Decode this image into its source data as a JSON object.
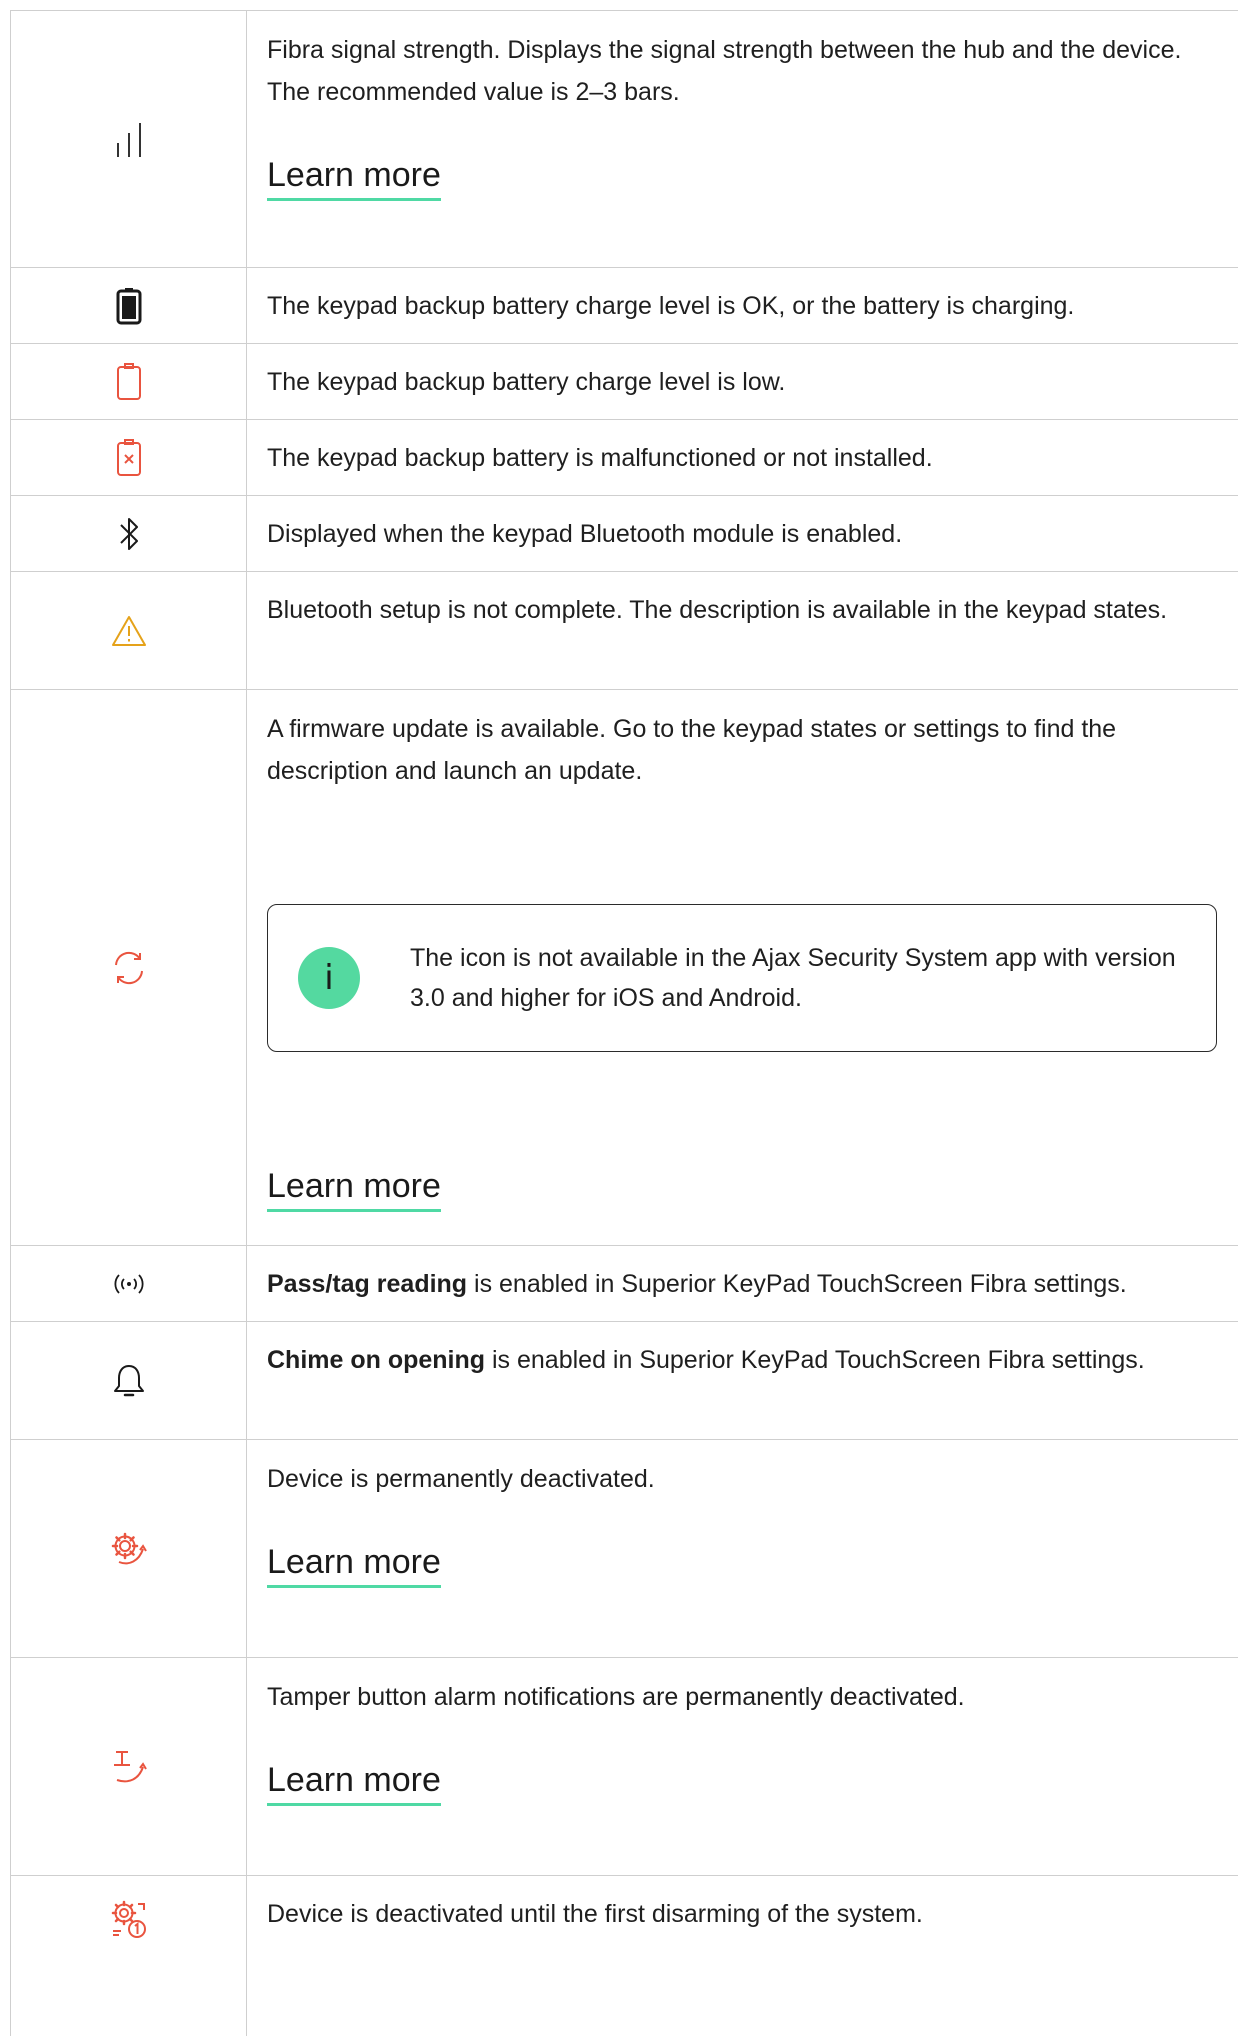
{
  "colors": {
    "red": "#e9543f",
    "yellow": "#e5a21a",
    "green": "#54d9a0",
    "border": "#cfcfcf"
  },
  "rows": [
    {
      "icon": "signal-strength-icon",
      "text": "Fibra signal strength. Displays the signal strength between the hub and the device. The recommended value is 2–3 bars.",
      "link": "Learn more"
    },
    {
      "icon": "battery-ok-icon",
      "text": "The keypad backup battery charge level is OK, or the battery is charging."
    },
    {
      "icon": "battery-low-icon",
      "text": "The keypad backup battery charge level is low."
    },
    {
      "icon": "battery-error-icon",
      "text": "The keypad backup battery is malfunctioned or not installed."
    },
    {
      "icon": "bluetooth-icon",
      "text": "Displayed when the keypad Bluetooth module is enabled."
    },
    {
      "icon": "warning-icon",
      "text": "Bluetooth setup is not complete. The description is available in the keypad states."
    },
    {
      "icon": "firmware-update-icon",
      "text": "A firmware update is available. Go to the keypad states or settings to find the description and launch an update.",
      "note": "The icon is not available in the Ajax Security System app with version 3.0 and higher for iOS and Android.",
      "note_icon": "info-icon",
      "note_glyph": "i",
      "link": "Learn more"
    },
    {
      "icon": "pass-tag-reading-icon",
      "bold": "Pass/tag reading",
      "text": " is enabled in Superior KeyPad TouchScreen Fibra settings."
    },
    {
      "icon": "chime-bell-icon",
      "bold": "Chime on opening",
      "text": " is enabled in Superior KeyPad TouchScreen Fibra settings."
    },
    {
      "icon": "device-deactivated-icon",
      "text": "Device is permanently deactivated.",
      "link": "Learn more"
    },
    {
      "icon": "tamper-deactivated-icon",
      "text": "Tamper button alarm notifications are permanently deactivated.",
      "link": "Learn more"
    },
    {
      "icon": "deactivated-until-disarm-icon",
      "text": "Device is deactivated until the first disarming of the system."
    }
  ]
}
